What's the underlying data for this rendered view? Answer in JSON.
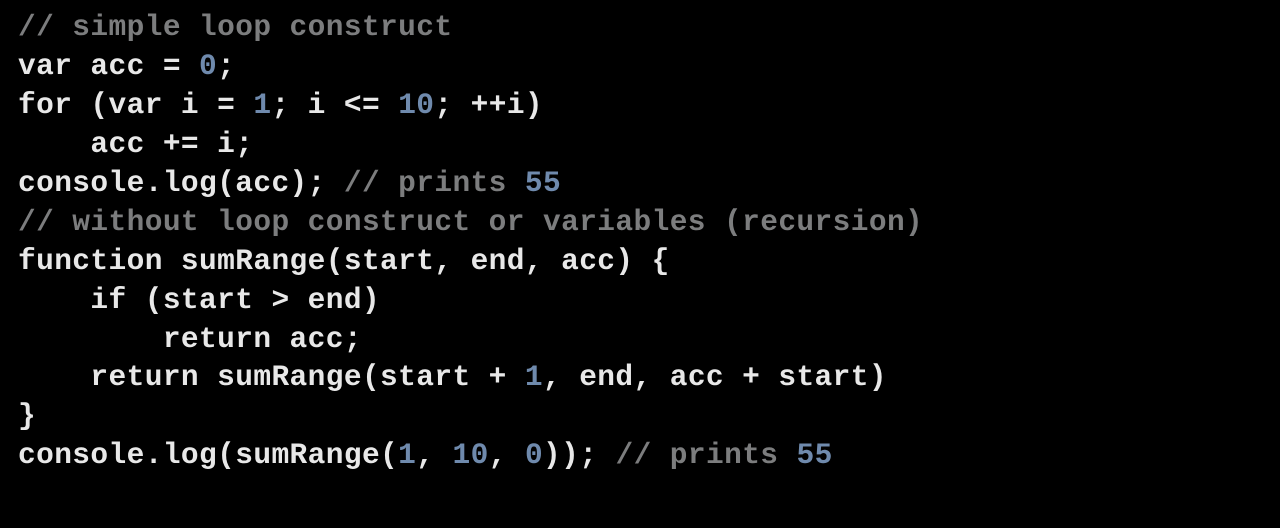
{
  "code": {
    "lines": [
      [
        {
          "cls": "tok-comment",
          "text": "// simple loop construct"
        }
      ],
      [
        {
          "cls": "tok-keyword",
          "text": "var acc = "
        },
        {
          "cls": "tok-num",
          "text": "0"
        },
        {
          "cls": "tok-keyword",
          "text": ";"
        }
      ],
      [
        {
          "cls": "tok-keyword",
          "text": "for (var i = "
        },
        {
          "cls": "tok-num",
          "text": "1"
        },
        {
          "cls": "tok-keyword",
          "text": "; i <= "
        },
        {
          "cls": "tok-num",
          "text": "10"
        },
        {
          "cls": "tok-keyword",
          "text": "; ++i)"
        }
      ],
      [
        {
          "cls": "tok-keyword",
          "text": "    acc += i;"
        }
      ],
      [
        {
          "cls": "tok-keyword",
          "text": "console.log(acc); "
        },
        {
          "cls": "tok-comment",
          "text": "// prints "
        },
        {
          "cls": "tok-num",
          "text": "55"
        }
      ],
      [
        {
          "cls": "tok-comment",
          "text": "// without loop construct or variables (recursion)"
        }
      ],
      [
        {
          "cls": "tok-keyword",
          "text": "function sumRange(start, end, acc) {"
        }
      ],
      [
        {
          "cls": "tok-keyword",
          "text": "    if (start > end)"
        }
      ],
      [
        {
          "cls": "tok-keyword",
          "text": "        return acc;"
        }
      ],
      [
        {
          "cls": "tok-keyword",
          "text": "    return sumRange(start + "
        },
        {
          "cls": "tok-num",
          "text": "1"
        },
        {
          "cls": "tok-keyword",
          "text": ", end, acc + start)"
        }
      ],
      [
        {
          "cls": "tok-keyword",
          "text": "}"
        }
      ],
      [
        {
          "cls": "tok-keyword",
          "text": "console.log(sumRange("
        },
        {
          "cls": "tok-num",
          "text": "1"
        },
        {
          "cls": "tok-keyword",
          "text": ", "
        },
        {
          "cls": "tok-num",
          "text": "10"
        },
        {
          "cls": "tok-keyword",
          "text": ", "
        },
        {
          "cls": "tok-num",
          "text": "0"
        },
        {
          "cls": "tok-keyword",
          "text": ")); "
        },
        {
          "cls": "tok-comment",
          "text": "// prints "
        },
        {
          "cls": "tok-num",
          "text": "55"
        }
      ]
    ]
  }
}
